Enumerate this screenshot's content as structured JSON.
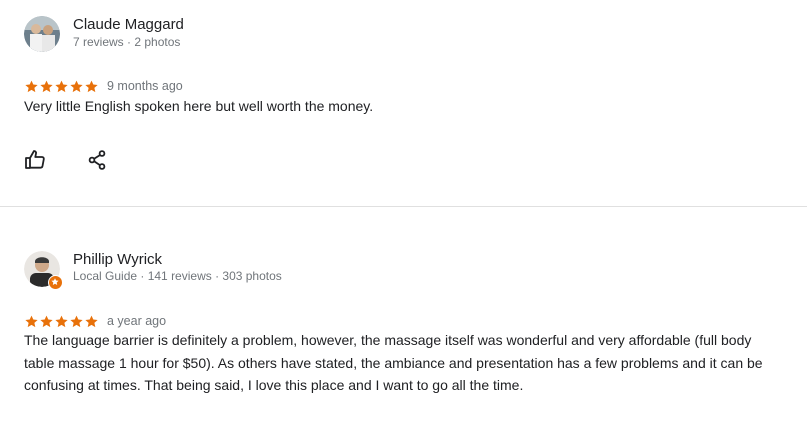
{
  "reviews": [
    {
      "author": "Claude Maggard",
      "meta": "7 reviews · 2 photos",
      "rating": 5,
      "time": "9 months ago",
      "text": "Very little English spoken here but well worth the money.",
      "actions": [
        "thumbs-up-icon",
        "share-icon"
      ]
    },
    {
      "author": "Phillip Wyrick",
      "meta": "Local Guide · 141 reviews · 303 photos",
      "rating": 5,
      "time": "a year ago",
      "text": "The language barrier is definitely a problem, however, the massage itself was wonderful and very affordable (full body table massage 1 hour for $50). As others have stated, the ambiance and presentation has a few problems and it can be confusing at times. That being said, I love this place and I want to go all the time."
    }
  ],
  "colors": {
    "star": "#e8710a",
    "meta_text": "#70757a",
    "body_text": "#202124",
    "divider": "#e0e0e0",
    "local_guide_badge": "#e8710a"
  }
}
